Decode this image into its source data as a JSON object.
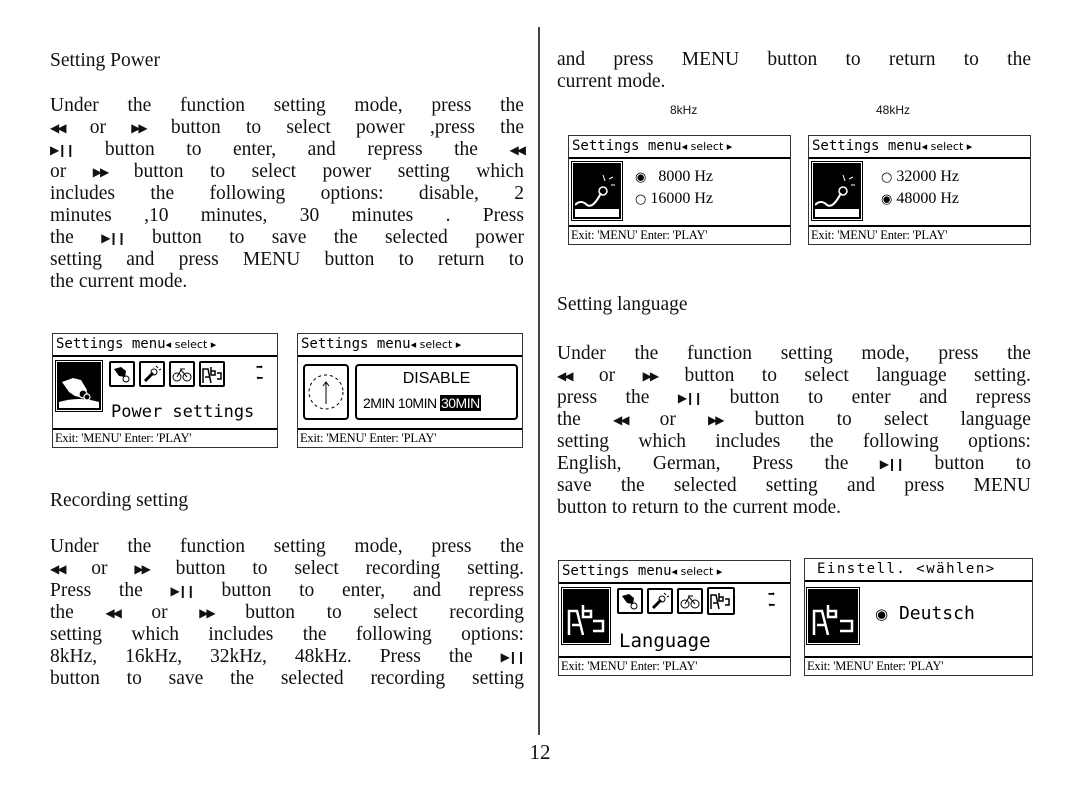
{
  "page_number": "12",
  "left": {
    "power": {
      "heading": "Setting Power",
      "lines": [
        "Under the function setting mode, press the",
        "◀◀ or ▶▶ button to select power ,press the",
        "▶❙❙ button to enter, and repress the ◀◀",
        "or ▶▶ button to select power setting which",
        "includes the following options: disable, 2",
        "minutes ,10 minutes, 30 minutes . Press",
        "the ▶❙❙ button to save the selected power",
        "setting and press MENU button to return to",
        "the current mode."
      ],
      "screens": [
        {
          "title": "Settings menu",
          "select": "◂ select ▸",
          "label": "Power settings",
          "footer": "Exit: 'MENU' Enter: 'PLAY'",
          "big_icon": "power-settings-icon",
          "small_icons": [
            "power-icon",
            "microphone-icon",
            "bicycle-icon",
            "language-abc-icon"
          ]
        },
        {
          "title": "Settings menu",
          "select": "◂ select ▸",
          "option_top": "DISABLE",
          "options": [
            "2MIN",
            "10MIN",
            "30MIN"
          ],
          "selected": "30MIN",
          "footer": "Exit: 'MENU' Enter: 'PLAY'",
          "big_icon": "clock-icon"
        }
      ]
    },
    "recording": {
      "heading": "Recording setting",
      "lines": [
        "Under the function setting mode, press the",
        "◀◀ or ▶▶ button to select recording setting.",
        "Press the ▶❙❙ button to enter, and repress",
        "the ◀◀ or ▶▶ button to select recording",
        "setting which includes the following options:",
        "8kHz, 16kHz, 32kHz, 48kHz. Press the ▶❙❙",
        "button to save the selected recording setting"
      ]
    }
  },
  "right": {
    "recording_cont": {
      "lines": [
        "and press MENU button to return to the",
        "current mode."
      ],
      "captions": [
        "8kHz",
        "48kHz"
      ],
      "screens": [
        {
          "title": "Settings menu",
          "select": "◂ select ▸",
          "options": [
            {
              "label": "8000 Hz",
              "selected": true
            },
            {
              "label": "16000 Hz",
              "selected": false
            }
          ],
          "footer": "Exit: 'MENU' Enter: 'PLAY'",
          "big_icon": "microphone-icon"
        },
        {
          "title": "Settings menu",
          "select": "◂ select ▸",
          "options": [
            {
              "label": "32000 Hz",
              "selected": false
            },
            {
              "label": "48000 Hz",
              "selected": true
            }
          ],
          "footer": "Exit: 'MENU' Enter: 'PLAY'",
          "big_icon": "microphone-icon"
        }
      ]
    },
    "language": {
      "heading": "Setting language",
      "lines": [
        "Under the function setting mode, press the",
        "◀◀ or ▶▶ button to select language setting.",
        "press the ▶❙❙ button to enter and repress",
        "the ◀◀ or ▶▶ button to select language",
        "setting which includes the following options:",
        "English, German, Press the ▶❙❙ button to",
        "save the selected setting and press MENU",
        "button to return to the current mode."
      ],
      "screens": [
        {
          "title": "Settings menu",
          "select": "◂ select ▸",
          "label": "Language",
          "footer": "Exit: 'MENU' Enter: 'PLAY'",
          "big_icon": "language-abc-icon",
          "small_icons": [
            "power-icon",
            "microphone-icon",
            "bicycle-icon",
            "language-abc-icon"
          ]
        },
        {
          "title": "Einstell. <wählen>",
          "option": {
            "label": "Deutsch",
            "selected": true
          },
          "footer": "Exit: 'MENU' Enter: 'PLAY'",
          "big_icon": "language-abc-icon"
        }
      ]
    }
  }
}
